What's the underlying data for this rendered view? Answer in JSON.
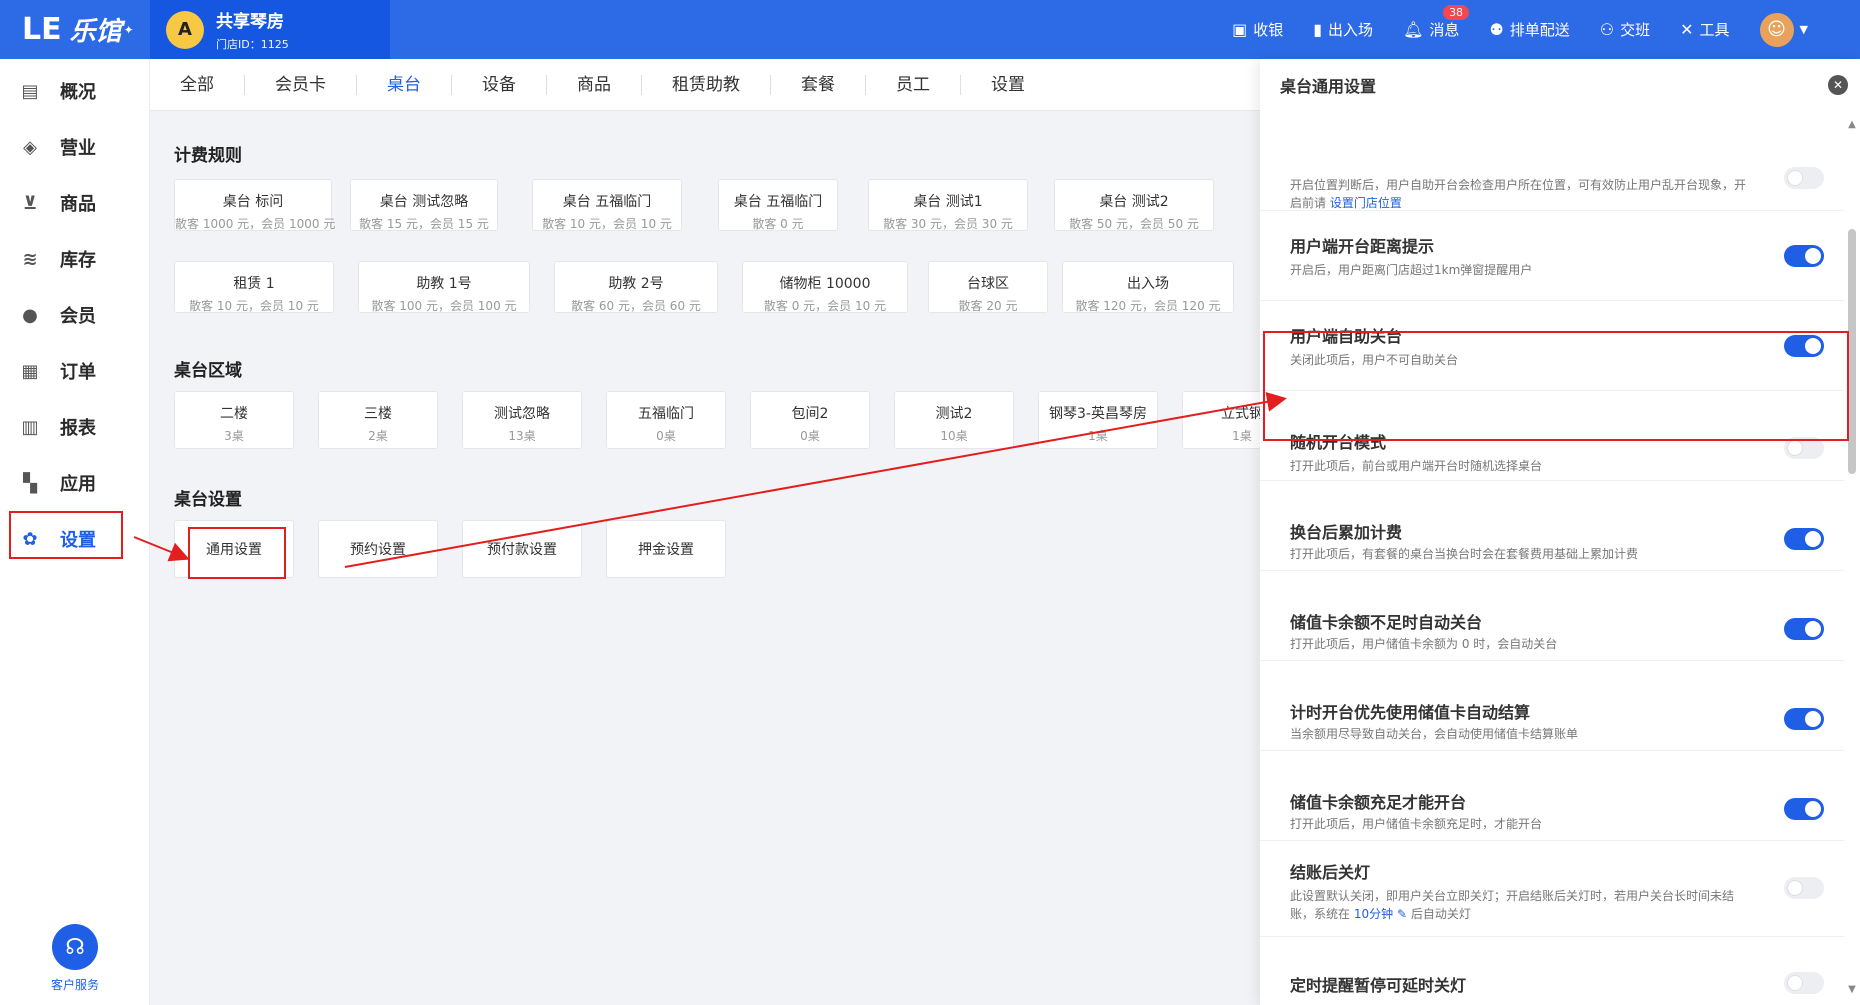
{
  "header": {
    "logo_mark": "LE",
    "logo_text": "乐馆",
    "store_avatar": "A",
    "store_name": "共享琴房",
    "store_id": "门店ID：1125",
    "actions": [
      {
        "icon": "cash-register-icon",
        "glyph": "▣",
        "label": "收银"
      },
      {
        "icon": "door-icon",
        "glyph": "▮",
        "label": "出入场"
      },
      {
        "icon": "bell-icon",
        "glyph": "♠",
        "label": "消息"
      },
      {
        "icon": "dispatch-icon",
        "glyph": "⚉",
        "label": "排单配送"
      },
      {
        "icon": "handover-icon",
        "glyph": "⚇",
        "label": "交班"
      },
      {
        "icon": "tools-icon",
        "glyph": "✕",
        "label": "工具"
      }
    ],
    "message_badge": "38"
  },
  "sidebar": {
    "items": [
      {
        "icon": "chart-icon",
        "glyph": "▤",
        "label": "概况"
      },
      {
        "icon": "money-bag-icon",
        "glyph": "◈",
        "label": "营业"
      },
      {
        "icon": "cart-icon",
        "glyph": "⊻",
        "label": "商品"
      },
      {
        "icon": "layers-icon",
        "glyph": "≋",
        "label": "库存"
      },
      {
        "icon": "member-icon",
        "glyph": "●",
        "label": "会员"
      },
      {
        "icon": "order-icon",
        "glyph": "▦",
        "label": "订单"
      },
      {
        "icon": "report-icon",
        "glyph": "▥",
        "label": "报表"
      },
      {
        "icon": "apps-icon",
        "glyph": "▚",
        "label": "应用"
      },
      {
        "icon": "gear-icon",
        "glyph": "✿",
        "label": "设置"
      }
    ],
    "service_label": "客户服务"
  },
  "tabs": [
    "全部",
    "会员卡",
    "桌台",
    "设备",
    "商品",
    "租赁助教",
    "套餐",
    "员工",
    "设置"
  ],
  "billing": {
    "title": "计费规则",
    "row1": [
      {
        "name": "桌台 标问",
        "sub": "散客 1000 元，会员 1000 元"
      },
      {
        "name": "桌台 测试忽略",
        "sub": "散客 15 元，会员 15 元"
      },
      {
        "name": "桌台 五福临门",
        "sub": "散客 10 元，会员 10 元"
      },
      {
        "name": "桌台 五福临门",
        "sub": "散客 0 元"
      },
      {
        "name": "桌台 测试1",
        "sub": "散客 30 元，会员 30 元"
      },
      {
        "name": "桌台 测试2",
        "sub": "散客 50 元，会员 50 元"
      }
    ],
    "row2": [
      {
        "name": "租赁 1",
        "sub": "散客 10 元，会员 10 元"
      },
      {
        "name": "助教 1号",
        "sub": "散客 100 元，会员 100 元"
      },
      {
        "name": "助教 2号",
        "sub": "散客 60 元，会员 60 元"
      },
      {
        "name": "储物柜 10000",
        "sub": "散客 0 元，会员 10 元"
      },
      {
        "name": "台球区",
        "sub": "散客 20 元"
      },
      {
        "name": "出入场",
        "sub": "散客 120 元，会员 120 元"
      }
    ]
  },
  "areas": {
    "title": "桌台区域",
    "items": [
      {
        "name": "二楼",
        "sub": "3桌"
      },
      {
        "name": "三楼",
        "sub": "2桌"
      },
      {
        "name": "测试忽略",
        "sub": "13桌"
      },
      {
        "name": "五福临门",
        "sub": "0桌"
      },
      {
        "name": "包间2",
        "sub": "0桌"
      },
      {
        "name": "测试2",
        "sub": "10桌"
      },
      {
        "name": "钢琴3-英昌琴房",
        "sub": "1桌"
      },
      {
        "name": "立式钢",
        "sub": "1桌"
      }
    ]
  },
  "table_settings": {
    "title": "桌台设置",
    "items": [
      "通用设置",
      "预约设置",
      "预付款设置",
      "押金设置"
    ]
  },
  "panel": {
    "title": "桌台通用设置",
    "close": "✕",
    "settings": [
      {
        "title": "",
        "desc_a": "开启位置判断后，用户自助开台会检查用户所在位置，可有效防止用户乱开台现象，开启前请 ",
        "link": "设置门店位置",
        "on": false
      },
      {
        "title": "用户端开台距离提示",
        "desc": "开启后，用户距离门店超过1km弹窗提醒用户",
        "on": true
      },
      {
        "title": "用户端自助关台",
        "desc": "关闭此项后，用户不可自助关台",
        "on": true
      },
      {
        "title": "随机开台模式",
        "desc": "打开此项后，前台或用户端开台时随机选择桌台",
        "on": false
      },
      {
        "title": "换台后累加计费",
        "desc": "打开此项后，有套餐的桌台当换台时会在套餐费用基础上累加计费",
        "on": true
      },
      {
        "title": "储值卡余额不足时自动关台",
        "desc": "打开此项后，用户储值卡余额为 0 时，会自动关台",
        "on": true
      },
      {
        "title": "计时开台优先使用储值卡自动结算",
        "desc": "当余额用尽导致自动关台，会自动使用储值卡结算账单",
        "on": true
      },
      {
        "title": "储值卡余额充足才能开台",
        "desc": "打开此项后，用户储值卡余额充足时，才能开台",
        "on": true
      },
      {
        "title": "结账后关灯",
        "desc_a": "此设置默认关闭，即用户关台立即关灯；开启结账后关灯时，若用户关台长时间未结账，系统在 ",
        "link": "10分钟",
        "edit": "✎",
        "desc_b": " 后自动关灯",
        "on": false
      },
      {
        "title": "定时提醒暂停可延时关灯",
        "on": false
      }
    ]
  }
}
